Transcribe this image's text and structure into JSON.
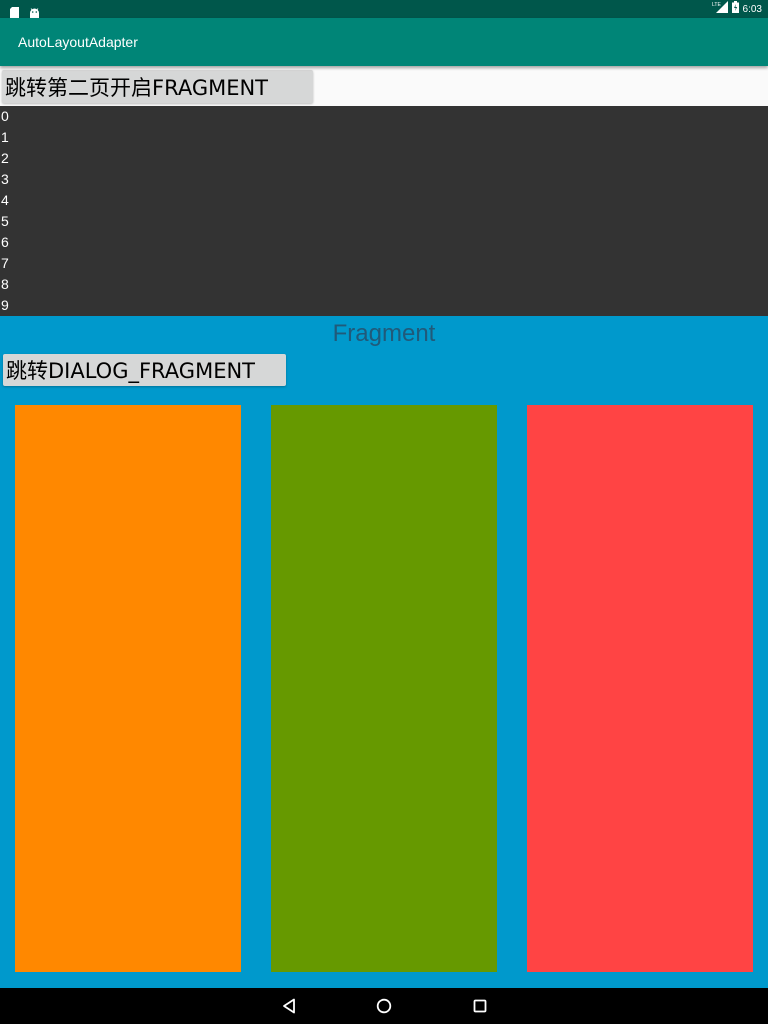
{
  "status_bar": {
    "time": "6:03",
    "network": "LTE",
    "left_icons": [
      "sd-card-icon",
      "android-icon"
    ],
    "right_icons": [
      "signal-icon",
      "battery-icon"
    ]
  },
  "app_bar": {
    "title": "AutoLayoutAdapter"
  },
  "main": {
    "second_page_button_label": "跳转第二页开启FRAGMENT",
    "list_items": [
      "0",
      "1",
      "2",
      "3",
      "4",
      "5",
      "6",
      "7",
      "8",
      "9"
    ]
  },
  "fragment": {
    "title": "Fragment",
    "dialog_button_label": "跳转DIALOG_FRAGMENT",
    "color_boxes": [
      {
        "name": "orange",
        "color": "#FF8800"
      },
      {
        "name": "green",
        "color": "#669900"
      },
      {
        "name": "red",
        "color": "#FF4444"
      }
    ]
  },
  "nav_bar": {
    "buttons": [
      "back-icon",
      "home-icon",
      "recents-icon"
    ]
  },
  "colors": {
    "status_bar": "#00574B",
    "app_bar": "#008577",
    "list_background": "#333333",
    "fragment_background": "#0099CC"
  }
}
